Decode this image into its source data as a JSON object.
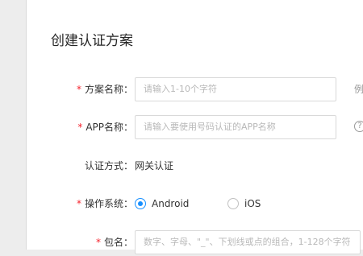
{
  "dialog": {
    "title": "创建认证方案"
  },
  "form": {
    "required_mark": "*",
    "scheme_name": {
      "label": "方案名称：",
      "placeholder": "请输入1-10个字符",
      "hint": "例"
    },
    "app_name": {
      "label": "APP名称：",
      "placeholder": "请输入要使用号码认证的APP名称",
      "help_icon": "?"
    },
    "auth_method": {
      "label": "认证方式：",
      "value": "网关认证"
    },
    "os": {
      "label": "操作系统：",
      "options": [
        {
          "label": "Android",
          "selected": true
        },
        {
          "label": "iOS",
          "selected": false
        }
      ]
    },
    "package_name": {
      "label": "包名：",
      "placeholder": "数字、字母、\"_\"、下划线或点的组合，1-128个字符"
    }
  },
  "colors": {
    "accent": "#1890ff",
    "required": "#f5222d"
  }
}
